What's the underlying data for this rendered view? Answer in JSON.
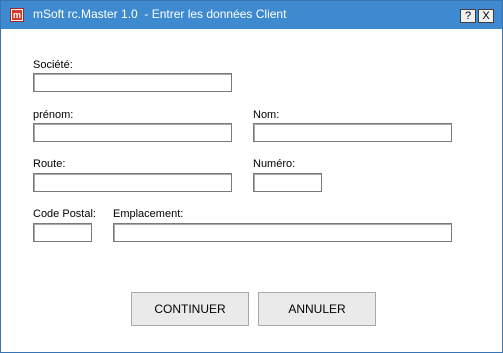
{
  "window": {
    "title": "mSoft rc.Master 1.0  - Entrer les données Client",
    "icon": "msoft-app-icon",
    "help_label": "?",
    "close_label": "X"
  },
  "form": {
    "societe_label": "Société:",
    "societe_value": "",
    "prenom_label": "prénom:",
    "prenom_value": "",
    "nom_label": "Nom:",
    "nom_value": "",
    "route_label": "Route:",
    "route_value": "",
    "numero_label": "Numéro:",
    "numero_value": "",
    "code_postal_label": "Code Postal:",
    "code_postal_value": "",
    "emplacement_label": "Emplacement:",
    "emplacement_value": ""
  },
  "buttons": {
    "continue_label": "CONTINUER",
    "cancel_label": "ANNULER"
  },
  "colors": {
    "titlebar": "#3d8ad0",
    "background": "#ffffff",
    "button_face": "#eaeaea"
  }
}
